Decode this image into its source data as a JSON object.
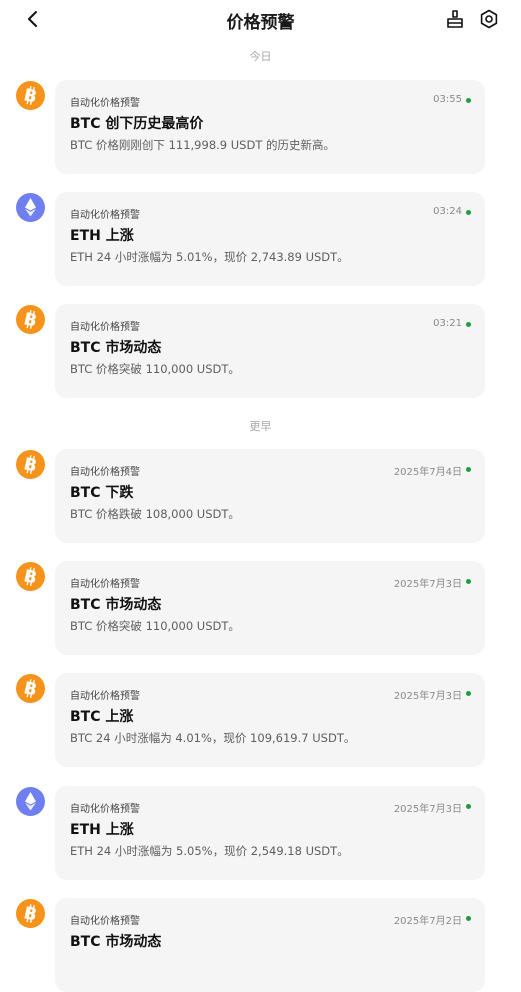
{
  "header": {
    "title": "价格预警",
    "back_icon": "chevron-left-icon",
    "clear_icon": "broom-icon",
    "settings_icon": "gear-icon"
  },
  "sections": {
    "today": "今日",
    "earlier": "更早"
  },
  "notifications": [
    {
      "coin": "BTC",
      "icon": "bitcoin-icon",
      "source": "自动化价格预警",
      "time": "03:55",
      "title": "BTC 创下历史最高价",
      "body": "BTC 价格刚刚创下 111,998.9 USDT 的历史新高。"
    },
    {
      "coin": "ETH",
      "icon": "ethereum-icon",
      "source": "自动化价格预警",
      "time": "03:24",
      "title": "ETH 上涨",
      "body": "ETH 24 小时涨幅为 5.01%，现价 2,743.89 USDT。"
    },
    {
      "coin": "BTC",
      "icon": "bitcoin-icon",
      "source": "自动化价格预警",
      "time": "03:21",
      "title": "BTC 市场动态",
      "body": "BTC 价格突破 110,000 USDT。"
    },
    {
      "coin": "BTC",
      "icon": "bitcoin-icon",
      "source": "自动化价格预警",
      "time": "2025年7月4日",
      "title": "BTC 下跌",
      "body": "BTC 价格跌破 108,000 USDT。"
    },
    {
      "coin": "BTC",
      "icon": "bitcoin-icon",
      "source": "自动化价格预警",
      "time": "2025年7月3日",
      "title": "BTC 市场动态",
      "body": "BTC 价格突破 110,000 USDT。"
    },
    {
      "coin": "BTC",
      "icon": "bitcoin-icon",
      "source": "自动化价格预警",
      "time": "2025年7月3日",
      "title": "BTC 上涨",
      "body": "BTC 24 小时涨幅为 4.01%，现价 109,619.7 USDT。"
    },
    {
      "coin": "ETH",
      "icon": "ethereum-icon",
      "source": "自动化价格预警",
      "time": "2025年7月3日",
      "title": "ETH 上涨",
      "body": "ETH 24 小时涨幅为 5.05%，现价 2,549.18 USDT。"
    },
    {
      "coin": "BTC",
      "icon": "bitcoin-icon",
      "source": "自动化价格预警",
      "time": "2025年7月2日",
      "title": "BTC 市场动态",
      "body": ""
    }
  ],
  "colors": {
    "btc": "#f7931a",
    "eth": "#6f7ff0",
    "unread_dot": "#1f9d3a"
  }
}
